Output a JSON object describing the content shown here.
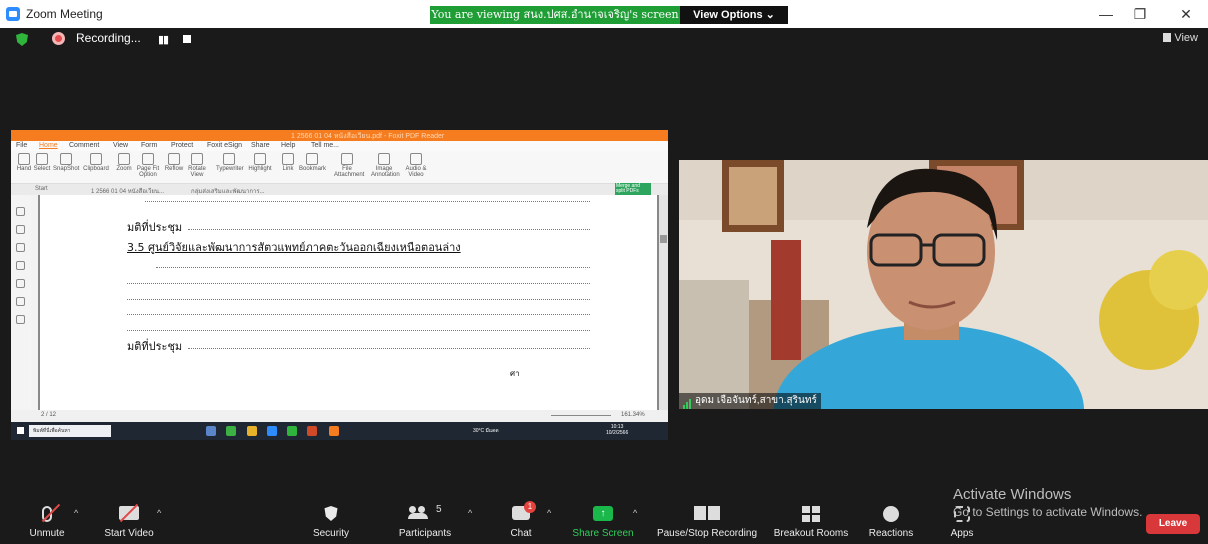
{
  "window": {
    "title": "Zoom Meeting",
    "share_banner": "You are viewing สนง.ปศส.อำนาจเจริญ's screen",
    "view_options": "View Options ⌄",
    "min": "—",
    "restore": "❐",
    "close": "✕"
  },
  "recording": {
    "label": "Recording...",
    "pause": "▮▮"
  },
  "view_button": "View",
  "shared_screen": {
    "app_filename": "1 2566 01 04 หนังสือเวียน.pdf - Foxit PDF Reader",
    "menu_tabs": [
      "File",
      "Home",
      "Comment",
      "View",
      "Form",
      "Protect",
      "Foxit eSign",
      "Share",
      "Help",
      "Tell me..."
    ],
    "tools": [
      "Hand",
      "Select",
      "SnapShot",
      "Clipboard",
      "Zoom",
      "Page Fit Option",
      "Reflow",
      "Rotate View",
      "Typewriter",
      "Highlight",
      "Link",
      "Bookmark",
      "File Attachment",
      "Image Annotation",
      "Audio & Video"
    ],
    "doc_tabs": [
      "Start",
      "1 2566 01 04 หนังสือเวียน...",
      "กลุ่มส่งเสริมและพัฒนาการ..."
    ],
    "merge_button": "Merge and split PDFs",
    "page_text": {
      "resolution1": "มติที่ประชุม",
      "heading": "3.5 ศูนย์วิจัยและพัฒนาการสัตวแพทย์ภาคตะวันออกเฉียงเหนือตอนล่าง",
      "resolution2": "มติที่ประชุม",
      "footer_mark": "ศา"
    },
    "status": {
      "page": "2 / 12",
      "zoom": "161.34%"
    },
    "taskbar": {
      "search": "พิมพ์ที่นี่เพื่อค้นหา",
      "weather": "30°C มีแดด",
      "time": "10:13",
      "date": "10/2/2566"
    }
  },
  "participant": {
    "name": "อุดม เจือจันทร์,สาขา.สุรินทร์"
  },
  "activation": {
    "title": "Activate Windows",
    "subtitle": "Go to Settings to activate Windows."
  },
  "toolbar": {
    "unmute": "Unmute",
    "start_video": "Start Video",
    "security": "Security",
    "participants": "Participants",
    "participant_count": "5",
    "chat": "Chat",
    "chat_badge": "1",
    "share_screen": "Share Screen",
    "pause_recording": "Pause/Stop Recording",
    "breakout_rooms": "Breakout Rooms",
    "reactions": "Reactions",
    "apps": "Apps",
    "leave": "Leave"
  },
  "colors": {
    "zoom_blue": "#2d8cff",
    "share_green": "#1f9e36",
    "leave_red": "#d8383a",
    "foxit_orange": "#f57c1f",
    "meeting_bg": "#1a1a1a"
  }
}
